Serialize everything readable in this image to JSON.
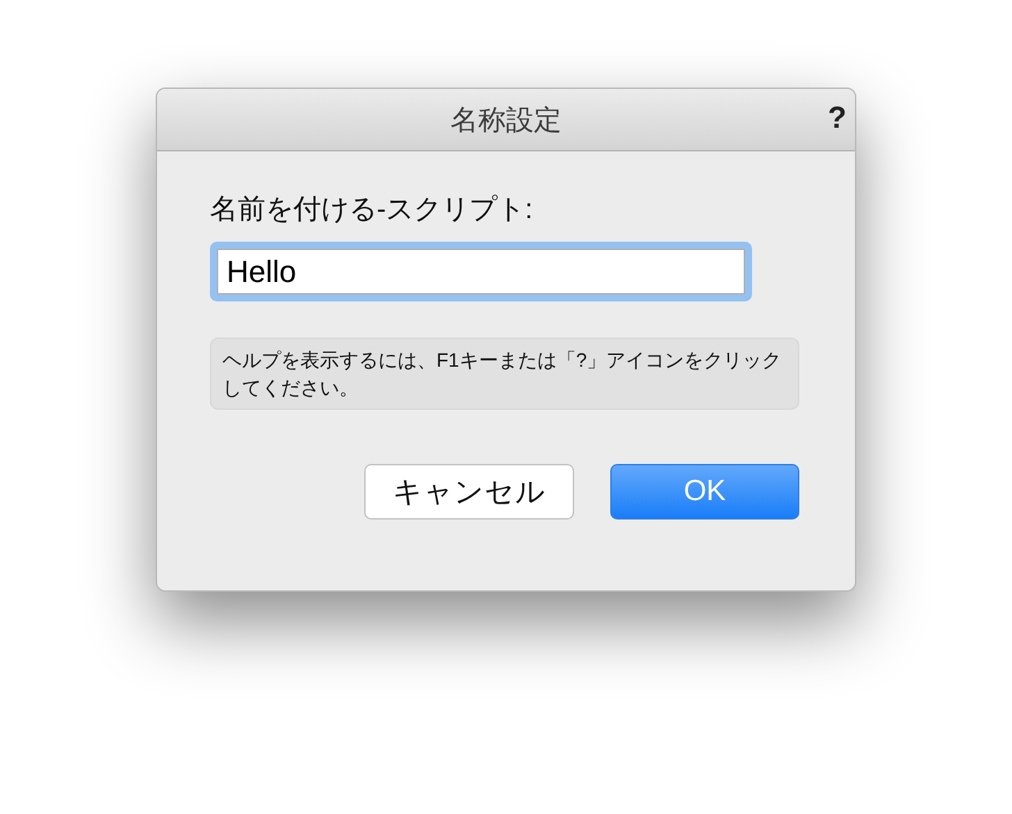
{
  "window": {
    "title": "名称設定",
    "help": "?"
  },
  "field": {
    "label": "名前を付ける-スクリプト:",
    "value": "Hello",
    "focused": true
  },
  "hint": "ヘルプを表示するには、F1キーまたは「?」アイコンをクリックしてください。",
  "buttons": [
    {
      "label": "キャンセル",
      "default": false
    },
    {
      "label": "OK",
      "default": true
    }
  ]
}
